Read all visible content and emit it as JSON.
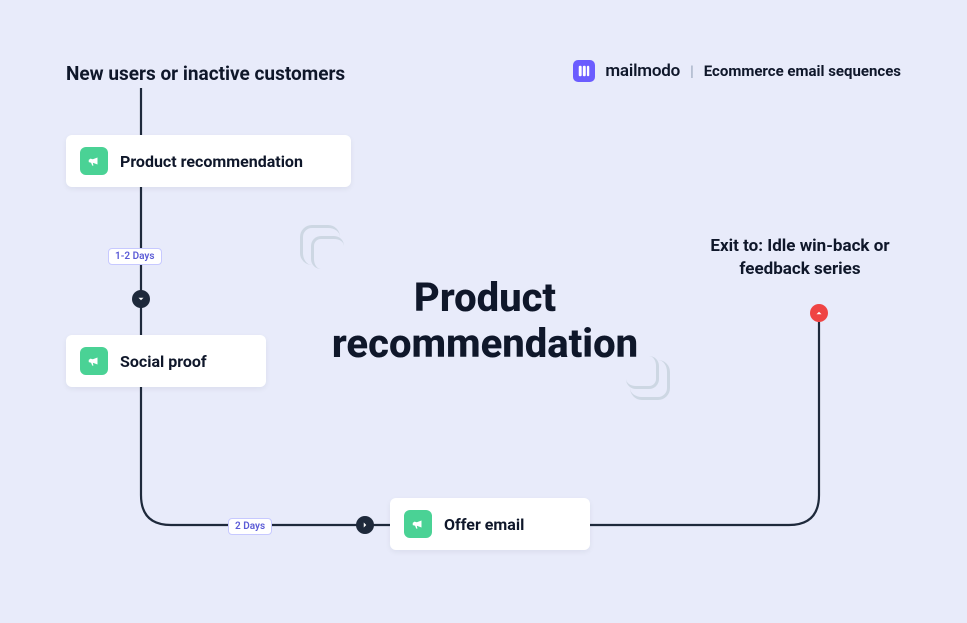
{
  "header": {
    "entry": "New users or inactive customers",
    "brand": "mailmodo",
    "subtitle": "Ecommerce email sequences"
  },
  "title": "Product recommendation",
  "steps": {
    "s1": "Product recommendation",
    "s2": "Social proof",
    "s3": "Offer email"
  },
  "delays": {
    "d1": "1-2 Days",
    "d2": "2 Days"
  },
  "exit": "Exit to: Idle win-back or feedback series"
}
